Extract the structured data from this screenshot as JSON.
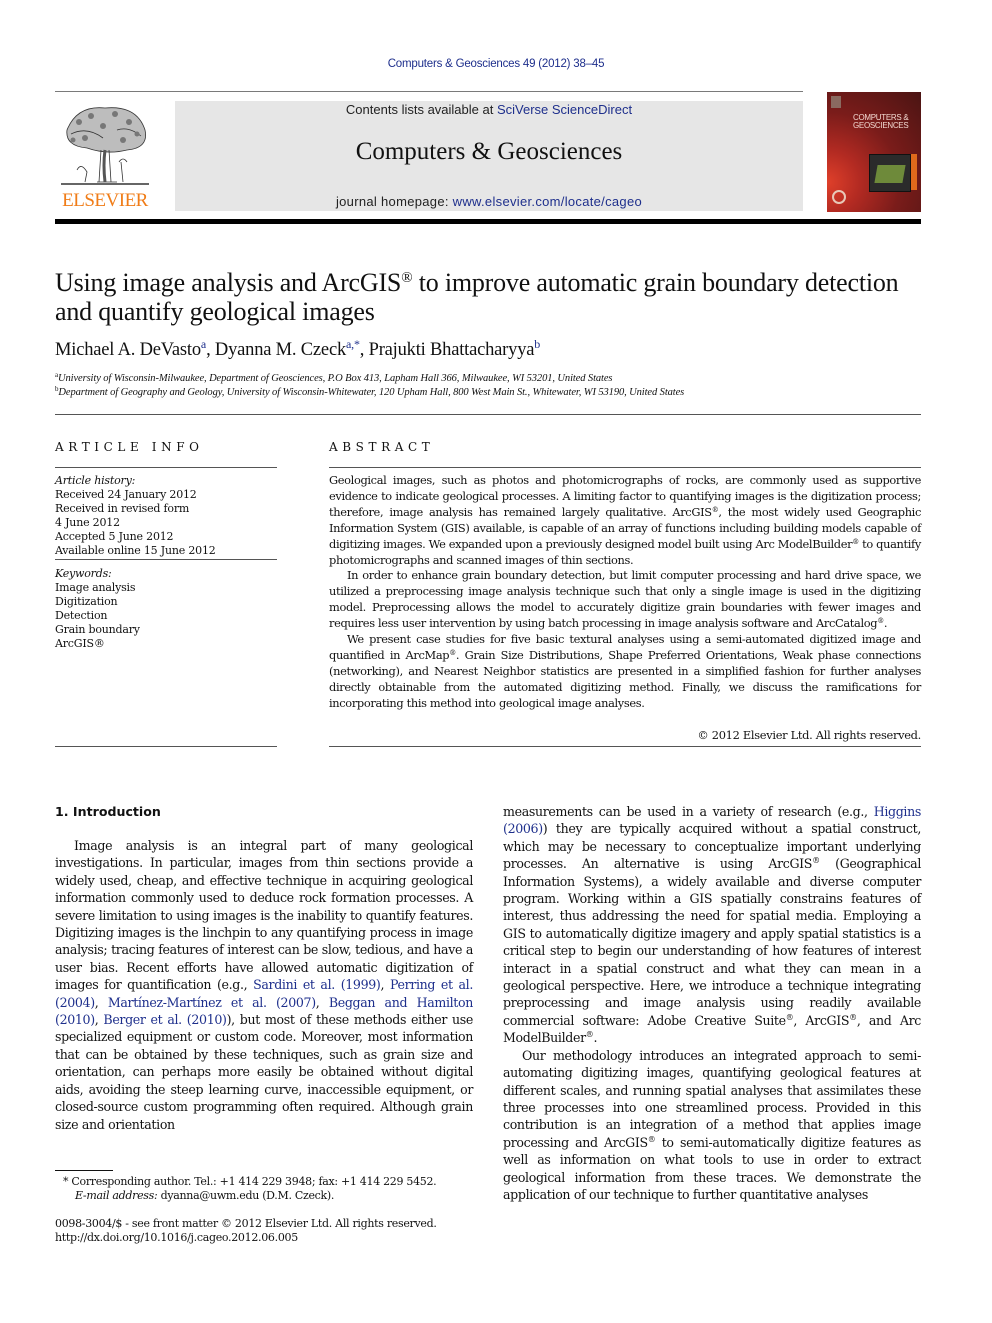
{
  "header": {
    "citation": "Computers & Geosciences 49 (2012) 38–45",
    "contents_prefix": "Contents lists available at ",
    "contents_link": "SciVerse ScienceDirect",
    "journal_title": "Computers & Geosciences",
    "homepage_prefix": "journal homepage: ",
    "homepage_link": "www.elsevier.com/locate/cageo",
    "publisher_logo_text": "ELSEVIER",
    "cover_title_line1": "COMPUTERS &",
    "cover_title_line2": "GEOSCIENCES",
    "publisher_color": "#f07c17",
    "link_color": "#1e2f8c"
  },
  "article": {
    "title_part1": "Using image analysis and ArcGIS",
    "title_reg": "®",
    "title_part2": " to improve automatic grain boundary detection and quantify geological images",
    "authors": [
      {
        "name": "Michael A. DeVasto",
        "sup": "a"
      },
      {
        "name": "Dyanna M. Czeck",
        "sup": "a,*"
      },
      {
        "name": "Prajukti Bhattacharyya",
        "sup": "b"
      }
    ],
    "affiliations": [
      {
        "sup": "a",
        "text": "University of Wisconsin-Milwaukee, Department of Geosciences, P.O Box 413, Lapham Hall 366, Milwaukee, WI 53201, United States"
      },
      {
        "sup": "b",
        "text": "Department of Geography and Geology, University of Wisconsin-Whitewater, 120 Upham Hall, 800 West Main St., Whitewater, WI 53190, United States"
      }
    ]
  },
  "article_info": {
    "heading": "ARTICLE INFO",
    "history_label": "Article history:",
    "history": [
      "Received 24 January 2012",
      "Received in revised form",
      "4 June 2012",
      "Accepted 5 June 2012",
      "Available online 15 June 2012"
    ],
    "keywords_label": "Keywords:",
    "keywords": [
      "Image analysis",
      "Digitization",
      "Detection",
      "Grain boundary",
      "ArcGIS®"
    ]
  },
  "abstract": {
    "heading": "ABSTRACT",
    "p1a": "Geological images, such as photos and photomicrographs of rocks, are commonly used as supportive evidence to indicate geological processes. A limiting factor to quantifying images is the digitization process; therefore, image analysis has remained largely qualitative. ArcGIS",
    "p1b": ", the most widely used Geographic Information System (GIS) available, is capable of an array of functions including building models capable of digitizing images. We expanded upon a previously designed model built using Arc ModelBuilder",
    "p1c": " to quantify photomicrographs and scanned images of thin sections.",
    "p2a": "In order to enhance grain boundary detection, but limit computer processing and hard drive space, we utilized a preprocessing image analysis technique such that only a single image is used in the digitizing model. Preprocessing allows the model to accurately digitize grain boundaries with fewer images and requires less user intervention by using batch processing in image analysis software and ArcCatalog",
    "p2b": ".",
    "p3a": "We present case studies for five basic textural analyses using a semi-automated digitized image and quantified in ArcMap",
    "p3b": ". Grain Size Distributions, Shape Preferred Orientations, Weak phase connections (networking), and Nearest Neighbor statistics are presented in a simplified fashion for further analyses directly obtainable from the automated digitizing method. Finally, we discuss the ramifications for incorporating this method into geological image analyses.",
    "reg": "®",
    "copyright": "© 2012 Elsevier Ltd. All rights reserved."
  },
  "intro": {
    "heading": "1.  Introduction",
    "left_p1a": "Image analysis is an integral part of many geological investigations. In particular, images from thin sections provide a widely used, cheap, and effective technique in acquiring geological information commonly used to deduce rock formation processes. A severe limitation to using images is the inability to quantify features. Digitizing images is the linchpin to any quantifying process in image analysis; tracing features of interest can be slow, tedious, and have a user bias. Recent efforts have allowed automatic digitization of images for quantification (e.g., ",
    "refs_left": [
      "Sardini et al. (1999)",
      "Perring et al. (2004)",
      "Martínez-Martínez et al. (2007)",
      "Beggan and Hamilton (2010)",
      "Berger et al. (2010)"
    ],
    "left_p1b": "), but most of these methods either use specialized equipment or custom code. Moreover, most information that can be obtained by these techniques, such as grain size and orientation, can perhaps more easily be obtained without digital aids, avoiding the steep learning curve, inaccessible equipment, or closed-source custom programming often required. Although grain size and orientation",
    "right_p1a": "measurements can be used in a variety of research (e.g., ",
    "ref_right": "Higgins (2006)",
    "right_p1b": ") they are typically acquired without a spatial construct, which may be necessary to conceptualize important underlying processes. An alternative is using ArcGIS",
    "right_p1c": " (Geographical Information Systems), a widely available and diverse computer program. Working within a GIS spatially constrains features of interest, thus addressing the need for spatial media. Employing a GIS to automatically digitize imagery and apply spatial statistics is a critical step to begin our understanding of how features of interest interact in a spatial construct and what they can mean in a geological perspective. Here, we introduce a technique integrating preprocessing and image analysis using readily available commercial software: Adobe Creative Suite",
    "right_p1d": ", ArcGIS",
    "right_p1e": ", and Arc ModelBuilder",
    "right_p1f": ".",
    "right_p2a": "Our methodology introduces an integrated approach to semi-automating digitizing images, quantifying geological features at different scales, and running spatial analyses that assimilates these three processes into one streamlined process. Provided in this contribution is an integration of a method that applies image processing and ArcGIS",
    "right_p2b": " to semi-automatically digitize features as well as information on what tools to use in order to extract geological information from these traces. We demonstrate the application of our technique to further quantitative analyses",
    "reg": "®"
  },
  "footnotes": {
    "corresponding": "* Corresponding author. Tel.: +1 414 229 3948; fax: +1 414 229 5452.",
    "email_label": "E-mail address:",
    "email_value": " dyanna@uwm.edu (D.M. Czeck).",
    "issn": "0098-3004/$ - see front matter © 2012 Elsevier Ltd. All rights reserved.",
    "doi": "http://dx.doi.org/10.1016/j.cageo.2012.06.005"
  }
}
